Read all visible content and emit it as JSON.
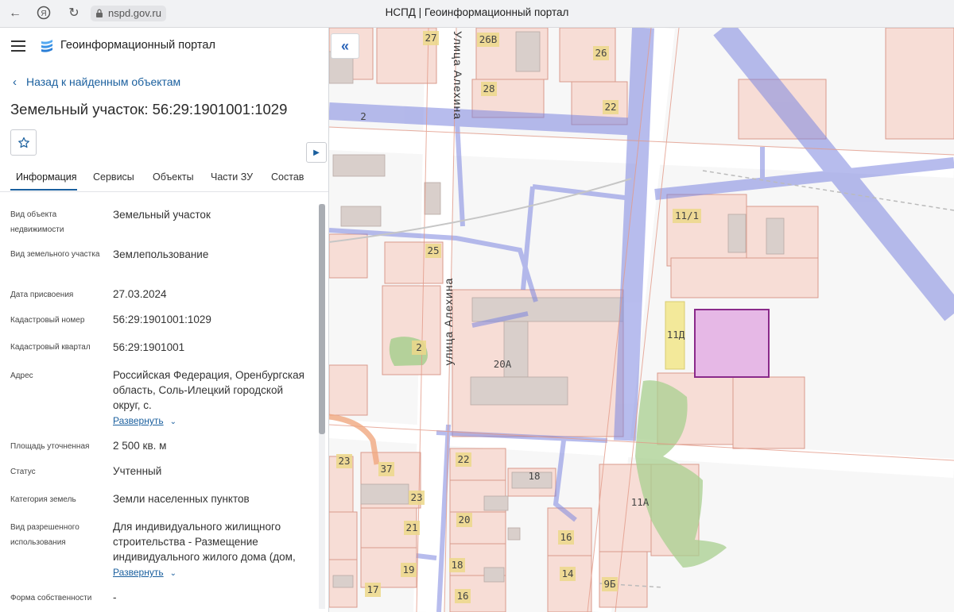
{
  "browser": {
    "url": "nspd.gov.ru",
    "tab_title": "НСПД | Геоинформационный портал"
  },
  "app": {
    "title": "Геоинформационный портал",
    "back_link": "Назад к найденным объектам",
    "heading": "Земельный участок: 56:29:1901001:1029"
  },
  "tabs": [
    "Информация",
    "Сервисы",
    "Объекты",
    "Части ЗУ",
    "Состав"
  ],
  "properties": {
    "p0": {
      "label": "Вид объекта недвижимости",
      "value": "Земельный участок"
    },
    "p1": {
      "label": "Вид земельного участка",
      "value": "Землепользование"
    },
    "p2": {
      "label": "Дата присвоения",
      "value": "27.03.2024"
    },
    "p3": {
      "label": "Кадастровый номер",
      "value": "56:29:1901001:1029"
    },
    "p4": {
      "label": "Кадастровый квартал",
      "value": "56:29:1901001"
    },
    "p5": {
      "label": "Адрес",
      "value": "Российская Федерация, Оренбургская область, Соль-Илецкий городской округ, с.",
      "expand": "Развернуть"
    },
    "p6": {
      "label": "Площадь уточненная",
      "value": "2 500 кв. м"
    },
    "p7": {
      "label": "Статус",
      "value": "Учтенный"
    },
    "p8": {
      "label": "Категория земель",
      "value": "Земли населенных пунктов"
    },
    "p9": {
      "label": "Вид разрешенного использования",
      "value": "Для индивидуального жилищного строительства - Размещение индивидуального жилого дома (дом,",
      "expand": "Развернуть"
    },
    "p10": {
      "label": "Форма собственности",
      "value": "-"
    }
  },
  "map": {
    "street_labels": [
      "Улица Алехина",
      "улица Алехина"
    ],
    "parcel_labels": [
      "27",
      "26В",
      "26",
      "28",
      "22",
      "2",
      "11/1",
      "25",
      "2",
      "20А",
      "11Д",
      "23",
      "37",
      "22",
      "18",
      "23",
      "20",
      "21",
      "11А",
      "16",
      "19",
      "18",
      "14",
      "17",
      "16",
      "9Б"
    ]
  },
  "colors": {
    "accent": "#1a5f9e",
    "parcel_fill": "#f7ddd6",
    "parcel_stroke": "#d99a8c",
    "selected_parcel": "#e6b8e6",
    "selected_stroke": "#8a2a8a",
    "utility_line": "#7d86e0",
    "building": "#d4c9c4",
    "green": "#a8cf8f",
    "label_tag": "#ecd88a"
  }
}
